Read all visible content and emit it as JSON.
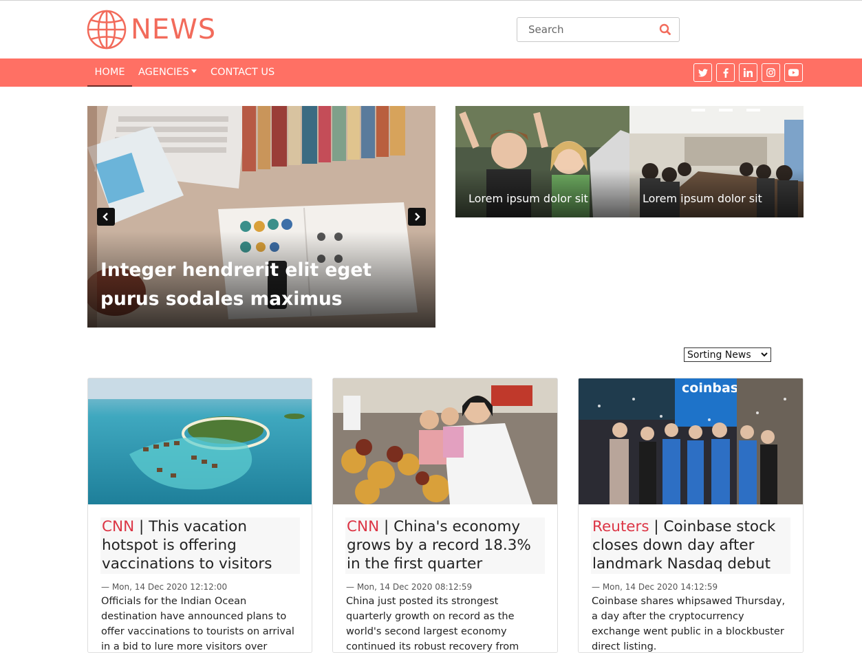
{
  "brand": {
    "logo_text": "NEWS",
    "accent": "#ff7064",
    "logo_icon": "globe-icon"
  },
  "search": {
    "placeholder": "Search",
    "icon": "search-icon"
  },
  "nav": {
    "items": [
      {
        "label": "HOME",
        "active": true
      },
      {
        "label": "AGENCIES",
        "dropdown": true
      },
      {
        "label": "CONTACT US"
      }
    ],
    "social": [
      "twitter-icon",
      "facebook-icon",
      "linkedin-icon",
      "instagram-icon",
      "youtube-icon"
    ]
  },
  "hero": {
    "main_title": "Integer hendrerit elit eget purus sodales maximus",
    "side": [
      {
        "caption": "Lorem ipsum dolor sit"
      },
      {
        "caption": "Lorem ipsum dolor sit"
      }
    ]
  },
  "sort": {
    "selected": "Sorting News"
  },
  "cards": [
    {
      "agency": "CNN",
      "title": " | This vacation hotspot is offering vaccinations to visitors",
      "date": "— Mon, 14 Dec 2020 12:12:00",
      "description": "Officials for the Indian Ocean destination have announced plans to offer vaccinations to tourists on arrival in a bid to lure more visitors over"
    },
    {
      "agency": "CNN",
      "title": " | China's economy grows by a record 18.3% in the first quarter",
      "date": "— Mon, 14 Dec 2020 08:12:59",
      "description": "China just posted its strongest quarterly growth on record as the world's second largest economy continued its robust recovery from"
    },
    {
      "agency": "Reuters",
      "title": " | Coinbase stock closes down day after landmark Nasdaq debut",
      "date": "— Mon, 14 Dec 2020 14:12:59",
      "description": "Coinbase shares whipsawed Thursday, a day after the cryptocurrency exchange went public in a blockbuster direct listing."
    }
  ]
}
